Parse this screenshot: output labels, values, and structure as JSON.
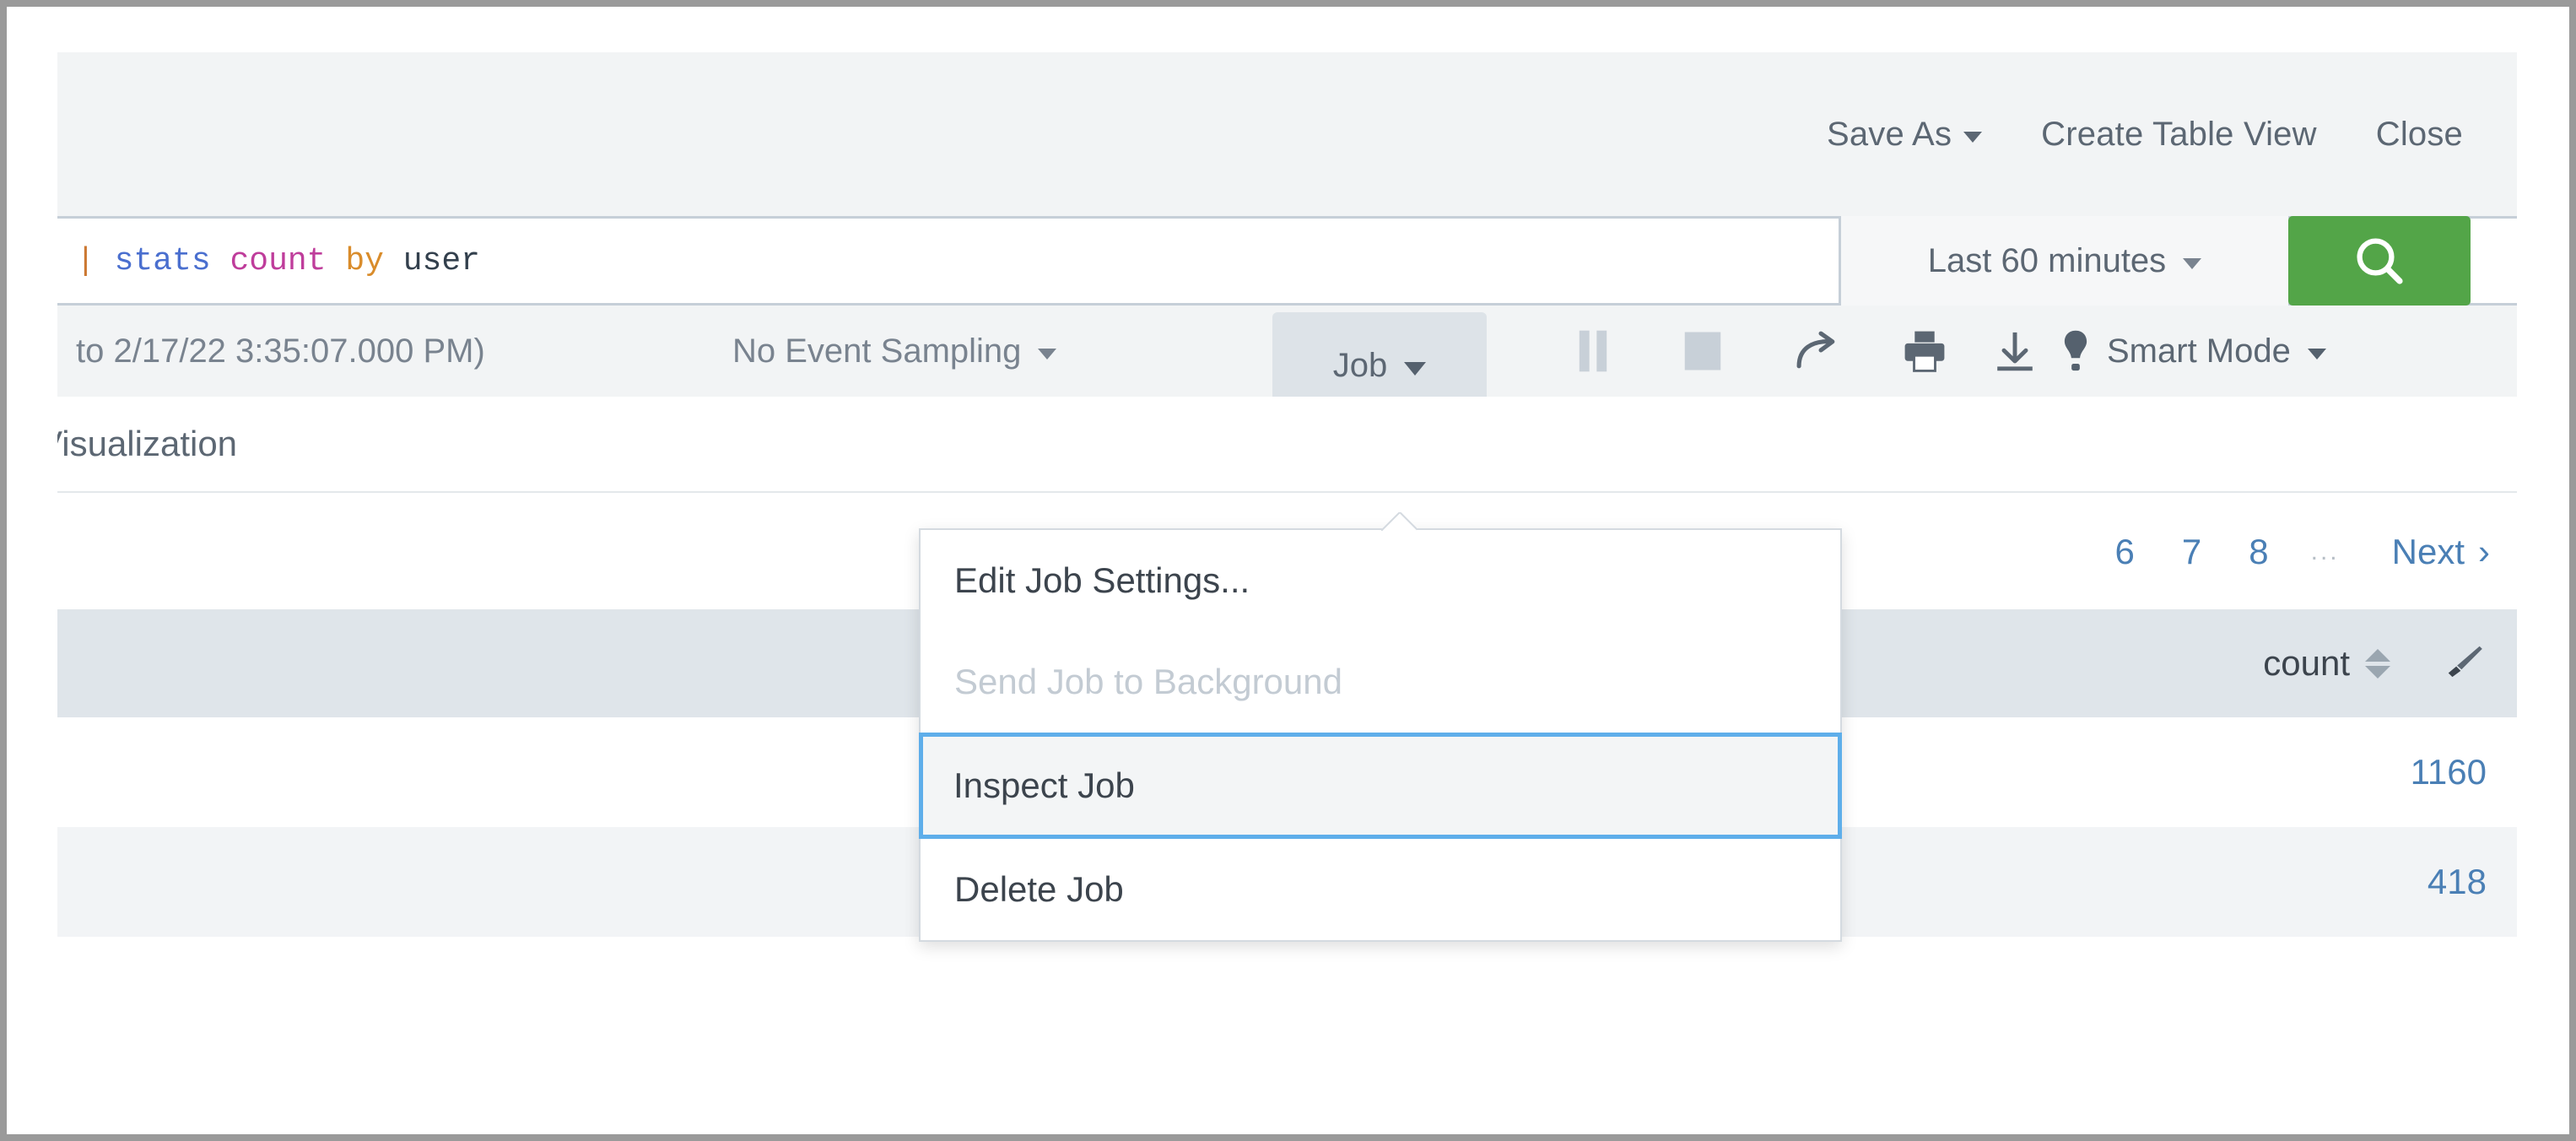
{
  "header": {
    "links": [
      {
        "label": "Save As",
        "has_caret": true,
        "name": "save-as"
      },
      {
        "label": "Create Table View",
        "has_caret": false,
        "name": "create-table-view"
      },
      {
        "label": "Close",
        "has_caret": false,
        "name": "close"
      }
    ]
  },
  "search": {
    "query_tokens": [
      {
        "text": "|",
        "type": "pipe"
      },
      {
        "text": " ",
        "type": "plain"
      },
      {
        "text": "stats",
        "type": "cmd"
      },
      {
        "text": " ",
        "type": "plain"
      },
      {
        "text": "count",
        "type": "func"
      },
      {
        "text": " ",
        "type": "plain"
      },
      {
        "text": "by",
        "type": "kw"
      },
      {
        "text": " ",
        "type": "plain"
      },
      {
        "text": "user",
        "type": "field"
      }
    ],
    "query_text": "| stats count by user",
    "time_range": "Last 60 minutes",
    "search_icon": "magnifier-icon",
    "search_button_color": "#53a548"
  },
  "toolbar": {
    "time_range_text": "to 2/17/22 3:35:07.000 PM)",
    "sampling": "No Event Sampling",
    "job_button": "Job",
    "icons": [
      {
        "name": "pause-icon",
        "disabled": true
      },
      {
        "name": "stop-icon",
        "disabled": true
      },
      {
        "name": "share-icon",
        "disabled": false
      },
      {
        "name": "print-icon",
        "disabled": false
      },
      {
        "name": "download-icon",
        "disabled": false
      }
    ],
    "mode": "Smart Mode",
    "mode_icon": "lightbulb-icon"
  },
  "tabs": {
    "visualization": "Visualization"
  },
  "pagination": {
    "items": [
      "6",
      "7",
      "8"
    ],
    "ellipsis": "...",
    "next": "Next",
    "next_chevron": "›"
  },
  "results_table": {
    "columns": [
      {
        "label": "count",
        "sortable": true,
        "format_icon": "paintbrush-icon"
      }
    ],
    "rows": [
      {
        "count": "1160"
      },
      {
        "count": "418"
      }
    ]
  },
  "job_menu": {
    "items": [
      {
        "label": "Edit Job Settings...",
        "state": "normal",
        "name": "edit-job-settings"
      },
      {
        "label": "Send Job to Background",
        "state": "disabled",
        "name": "send-job-to-background"
      },
      {
        "label": "Inspect Job",
        "state": "selected",
        "name": "inspect-job"
      },
      {
        "label": "Delete Job",
        "state": "normal",
        "name": "delete-job"
      }
    ],
    "highlight_color": "#5eaeea"
  }
}
